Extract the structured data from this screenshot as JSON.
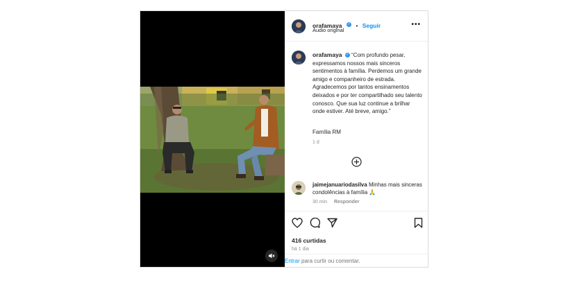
{
  "post": {
    "username": "orafamaya",
    "follow_label": "Seguir",
    "separator": "•",
    "audio_label": "Áudio original",
    "more_label": "•••",
    "caption": "“Com profundo pesar, expressamos nossos mais sinceros sentimentos à família. Perdemos um grande amigo e companheiro de estrada. Agradecemos por tantos ensinamentos deixados e por ter compartilhado seu talento conosco. Que sua luz continue a brilhar onde estiver. Até breve, amigo.”",
    "signature": "Família RM",
    "caption_time": "1 d"
  },
  "comment": {
    "username": "jaimejanuariodasilva",
    "text": "Minhas mais sinceras condolências à família 🙏",
    "time": "30 min",
    "reply_label": "Responder"
  },
  "actions": {
    "likes": "416 curtidas",
    "date": "há 1 dia"
  },
  "login": {
    "link": "Entrar",
    "text": "para curtir ou comentar."
  },
  "icons": {
    "verified": "verified-badge-icon",
    "more": "more-options-icon",
    "add_comments": "plus-circle-icon",
    "like": "heart-icon",
    "comment": "comment-icon",
    "share": "paper-plane-icon",
    "save": "bookmark-icon",
    "mute": "speaker-muted-icon"
  },
  "colors": {
    "accent": "#0095f6",
    "verified": "#3897f0",
    "text": "#262626",
    "secondary": "#8e8e8e"
  }
}
